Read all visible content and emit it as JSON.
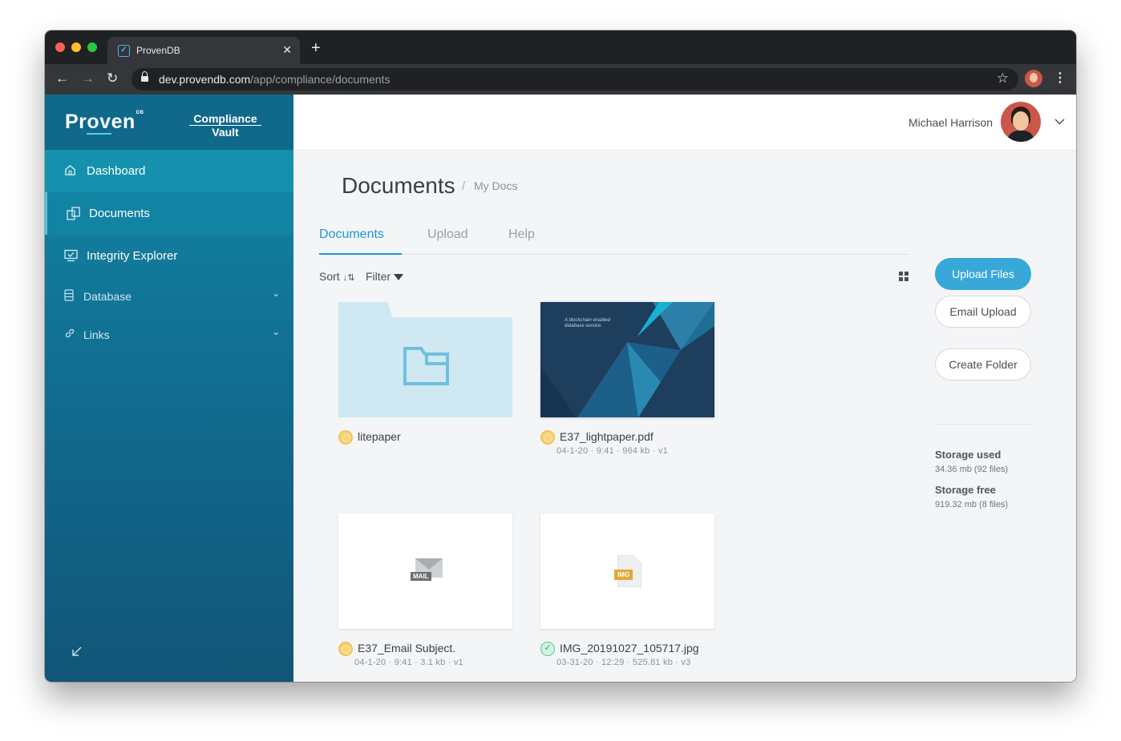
{
  "browser": {
    "tab_title": "ProvenDB",
    "url_host": "dev.provendb.com",
    "url_path": "/app/compliance/documents"
  },
  "brand": {
    "logo_pre": "Pr",
    "logo_v": "ov",
    "logo_post": "en",
    "logo_sup": "DB",
    "subtitle_1": "Compliance",
    "subtitle_2": "Vault"
  },
  "sidebar": {
    "items": [
      {
        "label": "Dashboard",
        "icon": "home-icon"
      },
      {
        "label": "Documents",
        "icon": "documents-icon"
      },
      {
        "label": "Integrity Explorer",
        "icon": "monitor-check-icon"
      },
      {
        "label": "Database",
        "icon": "database-icon"
      },
      {
        "label": "Links",
        "icon": "link-icon"
      }
    ]
  },
  "header": {
    "user_name": "Michael Harrison"
  },
  "page": {
    "title": "Documents",
    "breadcrumb_sep": "/",
    "breadcrumb": "My Docs"
  },
  "tabs": [
    {
      "label": "Documents",
      "active": true
    },
    {
      "label": "Upload",
      "active": false
    },
    {
      "label": "Help",
      "active": false
    }
  ],
  "toolbar": {
    "sort_label": "Sort",
    "filter_label": "Filter"
  },
  "files": [
    {
      "name": "litepaper",
      "info": "",
      "status": "pending",
      "type": "folder"
    },
    {
      "name": "E37_lightpaper.pdf",
      "info": "04-1-20 · 9:41 · 964 kb · v1",
      "status": "pending",
      "type": "pdf",
      "thumb_caption_1": "A blockchain enabled",
      "thumb_caption_2": "database service."
    },
    {
      "name": "E37_Email Subject.",
      "info": "04-1-20 · 9:41 · 3.1 kb · v1",
      "status": "pending",
      "type": "mail",
      "tag": "MAIL"
    },
    {
      "name": "IMG_20191027_105717.jpg",
      "info": "03-31-20 · 12:29 · 525.81 kb · v3",
      "status": "verified",
      "type": "image",
      "tag": "IMG"
    }
  ],
  "actions": {
    "upload_files": "Upload Files",
    "email_upload": "Email Upload",
    "create_folder": "Create Folder"
  },
  "storage": {
    "used_label": "Storage used",
    "used_value": "34.36 mb (92 files)",
    "free_label": "Storage free",
    "free_value": "919.32 mb (8 files)"
  },
  "colors": {
    "accent": "#1b9ad0",
    "primary_button": "#37a8d8",
    "sidebar_top": "#138aa6",
    "sidebar_bottom": "#115577"
  }
}
